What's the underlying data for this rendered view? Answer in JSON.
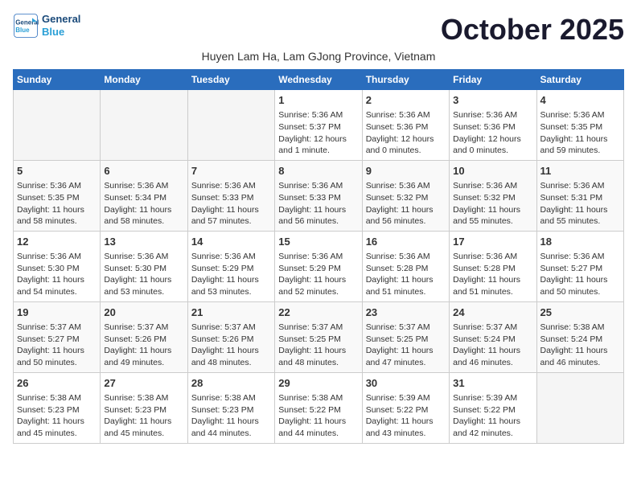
{
  "header": {
    "logo_line1": "General",
    "logo_line2": "Blue",
    "month_title": "October 2025",
    "subtitle": "Huyen Lam Ha, Lam GJong Province, Vietnam"
  },
  "days_of_week": [
    "Sunday",
    "Monday",
    "Tuesday",
    "Wednesday",
    "Thursday",
    "Friday",
    "Saturday"
  ],
  "weeks": [
    [
      {
        "day": "",
        "info": ""
      },
      {
        "day": "",
        "info": ""
      },
      {
        "day": "",
        "info": ""
      },
      {
        "day": "1",
        "info": "Sunrise: 5:36 AM\nSunset: 5:37 PM\nDaylight: 12 hours\nand 1 minute."
      },
      {
        "day": "2",
        "info": "Sunrise: 5:36 AM\nSunset: 5:36 PM\nDaylight: 12 hours\nand 0 minutes."
      },
      {
        "day": "3",
        "info": "Sunrise: 5:36 AM\nSunset: 5:36 PM\nDaylight: 12 hours\nand 0 minutes."
      },
      {
        "day": "4",
        "info": "Sunrise: 5:36 AM\nSunset: 5:35 PM\nDaylight: 11 hours\nand 59 minutes."
      }
    ],
    [
      {
        "day": "5",
        "info": "Sunrise: 5:36 AM\nSunset: 5:35 PM\nDaylight: 11 hours\nand 58 minutes."
      },
      {
        "day": "6",
        "info": "Sunrise: 5:36 AM\nSunset: 5:34 PM\nDaylight: 11 hours\nand 58 minutes."
      },
      {
        "day": "7",
        "info": "Sunrise: 5:36 AM\nSunset: 5:33 PM\nDaylight: 11 hours\nand 57 minutes."
      },
      {
        "day": "8",
        "info": "Sunrise: 5:36 AM\nSunset: 5:33 PM\nDaylight: 11 hours\nand 56 minutes."
      },
      {
        "day": "9",
        "info": "Sunrise: 5:36 AM\nSunset: 5:32 PM\nDaylight: 11 hours\nand 56 minutes."
      },
      {
        "day": "10",
        "info": "Sunrise: 5:36 AM\nSunset: 5:32 PM\nDaylight: 11 hours\nand 55 minutes."
      },
      {
        "day": "11",
        "info": "Sunrise: 5:36 AM\nSunset: 5:31 PM\nDaylight: 11 hours\nand 55 minutes."
      }
    ],
    [
      {
        "day": "12",
        "info": "Sunrise: 5:36 AM\nSunset: 5:30 PM\nDaylight: 11 hours\nand 54 minutes."
      },
      {
        "day": "13",
        "info": "Sunrise: 5:36 AM\nSunset: 5:30 PM\nDaylight: 11 hours\nand 53 minutes."
      },
      {
        "day": "14",
        "info": "Sunrise: 5:36 AM\nSunset: 5:29 PM\nDaylight: 11 hours\nand 53 minutes."
      },
      {
        "day": "15",
        "info": "Sunrise: 5:36 AM\nSunset: 5:29 PM\nDaylight: 11 hours\nand 52 minutes."
      },
      {
        "day": "16",
        "info": "Sunrise: 5:36 AM\nSunset: 5:28 PM\nDaylight: 11 hours\nand 51 minutes."
      },
      {
        "day": "17",
        "info": "Sunrise: 5:36 AM\nSunset: 5:28 PM\nDaylight: 11 hours\nand 51 minutes."
      },
      {
        "day": "18",
        "info": "Sunrise: 5:36 AM\nSunset: 5:27 PM\nDaylight: 11 hours\nand 50 minutes."
      }
    ],
    [
      {
        "day": "19",
        "info": "Sunrise: 5:37 AM\nSunset: 5:27 PM\nDaylight: 11 hours\nand 50 minutes."
      },
      {
        "day": "20",
        "info": "Sunrise: 5:37 AM\nSunset: 5:26 PM\nDaylight: 11 hours\nand 49 minutes."
      },
      {
        "day": "21",
        "info": "Sunrise: 5:37 AM\nSunset: 5:26 PM\nDaylight: 11 hours\nand 48 minutes."
      },
      {
        "day": "22",
        "info": "Sunrise: 5:37 AM\nSunset: 5:25 PM\nDaylight: 11 hours\nand 48 minutes."
      },
      {
        "day": "23",
        "info": "Sunrise: 5:37 AM\nSunset: 5:25 PM\nDaylight: 11 hours\nand 47 minutes."
      },
      {
        "day": "24",
        "info": "Sunrise: 5:37 AM\nSunset: 5:24 PM\nDaylight: 11 hours\nand 46 minutes."
      },
      {
        "day": "25",
        "info": "Sunrise: 5:38 AM\nSunset: 5:24 PM\nDaylight: 11 hours\nand 46 minutes."
      }
    ],
    [
      {
        "day": "26",
        "info": "Sunrise: 5:38 AM\nSunset: 5:23 PM\nDaylight: 11 hours\nand 45 minutes."
      },
      {
        "day": "27",
        "info": "Sunrise: 5:38 AM\nSunset: 5:23 PM\nDaylight: 11 hours\nand 45 minutes."
      },
      {
        "day": "28",
        "info": "Sunrise: 5:38 AM\nSunset: 5:23 PM\nDaylight: 11 hours\nand 44 minutes."
      },
      {
        "day": "29",
        "info": "Sunrise: 5:38 AM\nSunset: 5:22 PM\nDaylight: 11 hours\nand 44 minutes."
      },
      {
        "day": "30",
        "info": "Sunrise: 5:39 AM\nSunset: 5:22 PM\nDaylight: 11 hours\nand 43 minutes."
      },
      {
        "day": "31",
        "info": "Sunrise: 5:39 AM\nSunset: 5:22 PM\nDaylight: 11 hours\nand 42 minutes."
      },
      {
        "day": "",
        "info": ""
      }
    ]
  ]
}
